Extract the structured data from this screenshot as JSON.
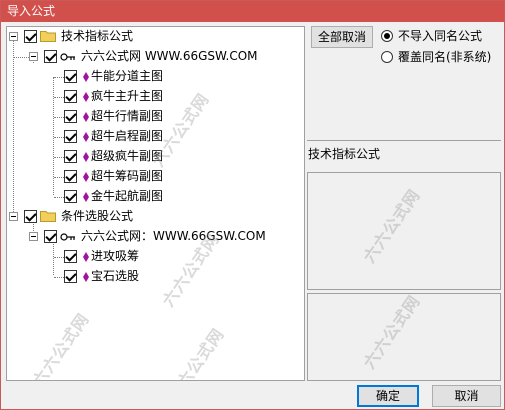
{
  "window": {
    "title": "导入公式"
  },
  "tree": {
    "groups": [
      {
        "label": "技术指标公式",
        "source": "六六公式网 WWW.66GSW.COM",
        "items": [
          "牛能分道主图",
          "疯牛主升主图",
          "超牛行情副图",
          "超牛启程副图",
          "超级疯牛副图",
          "超牛筹码副图",
          "金牛起航副图"
        ]
      },
      {
        "label": "条件选股公式",
        "source": "六六公式网：WWW.66GSW.COM",
        "items": [
          "进攻吸筹",
          "宝石选股"
        ]
      }
    ]
  },
  "options": {
    "cancel_all_label": "全部取消",
    "radio_no_import": "不导入同名公式",
    "radio_overwrite": "覆盖同名(非系统)"
  },
  "detail": {
    "type_label": "技术指标公式"
  },
  "footer": {
    "ok_label": "确定",
    "cancel_label": "取消"
  },
  "watermark": {
    "text": "六六公式网"
  },
  "colors": {
    "title_bar": "#d2504c",
    "item_icon": "#a0149b",
    "folder": "#f2cf5a"
  }
}
